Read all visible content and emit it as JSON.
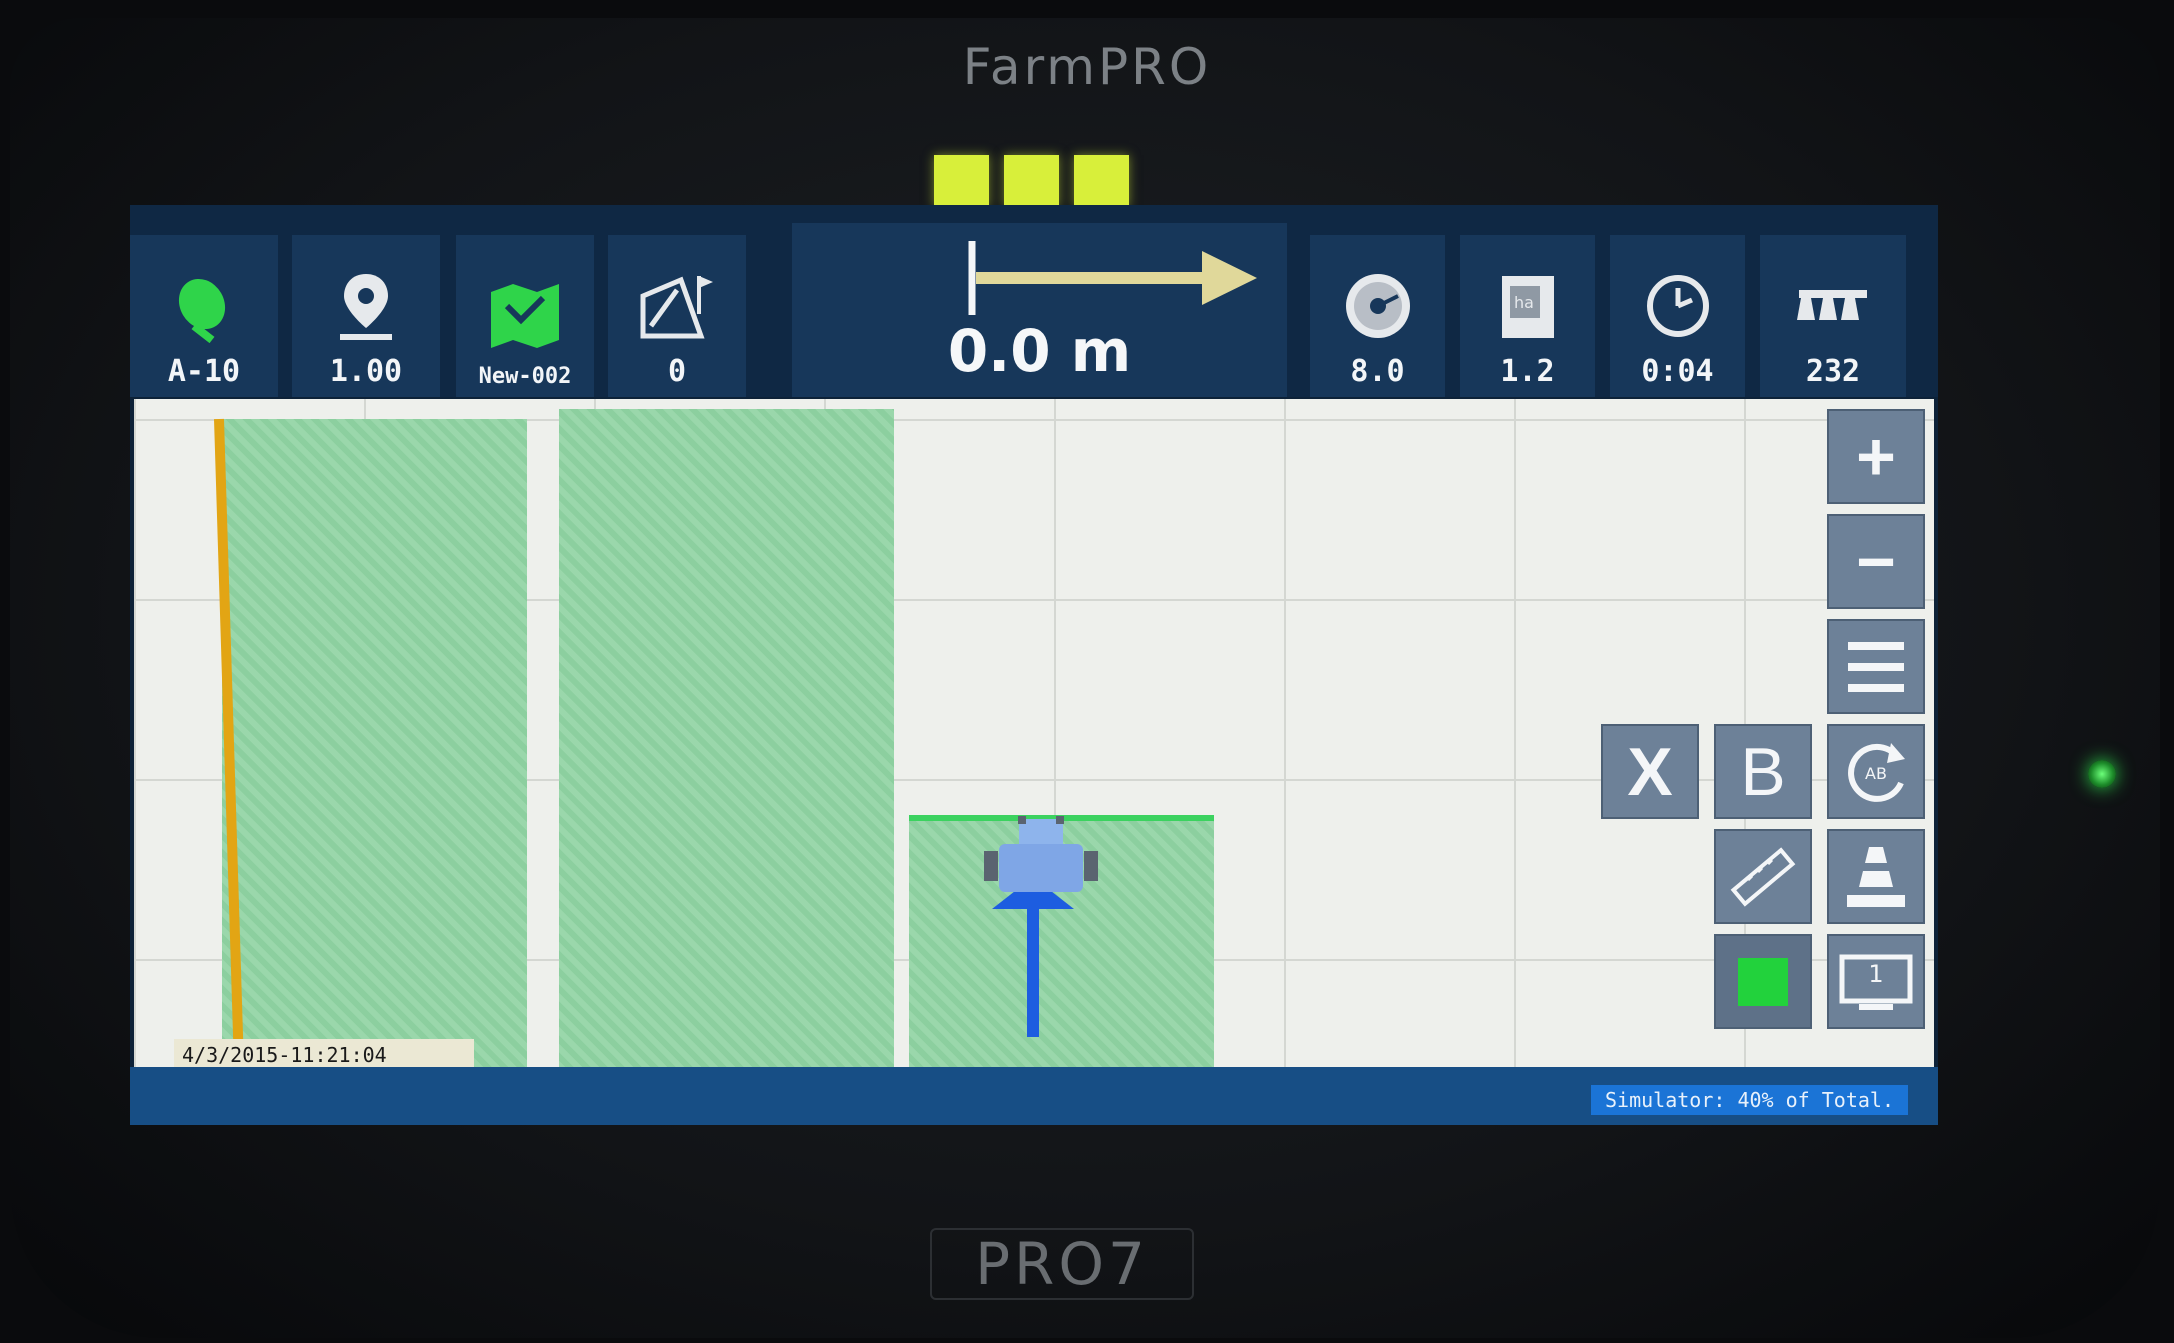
{
  "device": {
    "brand": "FarmPRO",
    "model": "PRO7",
    "indicator_lights": 3,
    "indicator_color": "#d8ef3a"
  },
  "topbar": {
    "tiles": [
      {
        "icon": "satellite-dish-icon",
        "value": "A-10"
      },
      {
        "icon": "location-pin-icon",
        "value": "1.00"
      },
      {
        "icon": "field-map-icon",
        "value": "New-002"
      },
      {
        "icon": "field-flag-icon",
        "value": "0"
      },
      {
        "icon": "speedometer-icon",
        "value": "8.0"
      },
      {
        "icon": "hectare-area-icon",
        "value": "1.2"
      },
      {
        "icon": "clock-icon",
        "value": "0:04"
      },
      {
        "icon": "boom-sections-icon",
        "value": "232"
      }
    ],
    "guidance": {
      "icon": "cross-track-arrow-icon",
      "distance": "0.0 m"
    }
  },
  "map": {
    "coverage_color": "#8fd3a2",
    "boundary_color": "#e2a514",
    "vehicle_color": "#7fa6e6",
    "heading_color": "#1d5de0",
    "timestamp": "4/3/2015-11:21:04"
  },
  "controls": {
    "zoom_in": "+",
    "zoom_out": "−",
    "menu": "menu-icon",
    "cancel": "X",
    "point_b": "B",
    "reset_ab": "reset-ab-icon",
    "measure": "ruler-icon",
    "headland": "cone-icon",
    "section": "section-status-icon",
    "screen": "screen-layout-icon",
    "screen_number": "1"
  },
  "status": {
    "message": "Simulator: 40% of Total."
  }
}
